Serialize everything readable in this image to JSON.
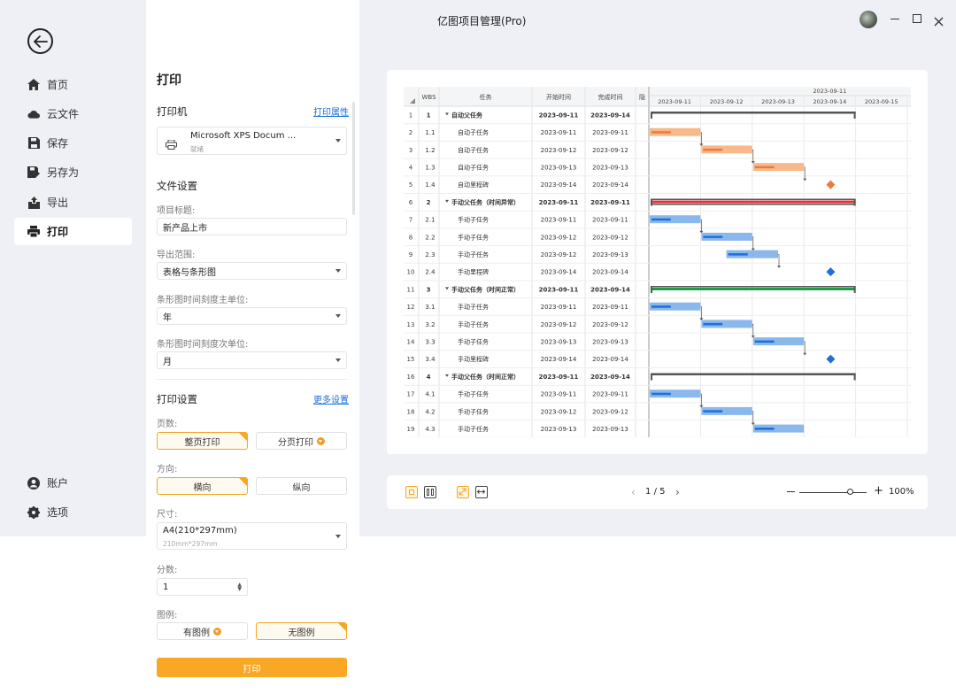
{
  "app": {
    "title": "亿图项目管理(Pro)"
  },
  "nav": {
    "items": [
      {
        "label": "首页",
        "icon": "home-icon"
      },
      {
        "label": "云文件",
        "icon": "cloud-icon"
      },
      {
        "label": "保存",
        "icon": "save-icon"
      },
      {
        "label": "另存为",
        "icon": "save-as-icon"
      },
      {
        "label": "导出",
        "icon": "export-icon"
      },
      {
        "label": "打印",
        "icon": "printer-icon",
        "active": true
      }
    ],
    "bottom": [
      {
        "label": "账户",
        "icon": "account-icon"
      },
      {
        "label": "选项",
        "icon": "gear-icon"
      }
    ]
  },
  "panel": {
    "title": "打印",
    "printer_section": "打印机",
    "printer_props_link": "打印属性",
    "printer_name": "Microsoft XPS Docum ...",
    "printer_status": "就绪",
    "file_settings": "文件设置",
    "project_title_label": "项目标题:",
    "project_title_value": "新产品上市",
    "export_range_label": "导出范围:",
    "export_range_value": "表格与条形图",
    "major_unit_label": "条形图时间刻度主单位:",
    "major_unit_value": "年",
    "minor_unit_label": "条形图时间刻度次单位:",
    "minor_unit_value": "月",
    "print_settings": "打印设置",
    "more_settings_link": "更多设置",
    "pages_label": "页数:",
    "pages_options": [
      "整页打印",
      "分页打印"
    ],
    "orientation_label": "方向:",
    "orientation_options": [
      "横向",
      "纵向"
    ],
    "size_label": "尺寸:",
    "size_value": "A4(210*297mm)",
    "size_sub": "210mm*297mm",
    "copies_label": "分数:",
    "copies_value": "1",
    "legend_label": "图例:",
    "legend_options": [
      "有图例",
      "无图例"
    ],
    "print_button": "打印"
  },
  "gantt": {
    "headers": {
      "wbs": "WBS",
      "task": "任务",
      "start": "开始时间",
      "finish": "完成时间",
      "extra": "隐"
    },
    "timeline_top": "2023-09-11",
    "dates": [
      "2023-09-11",
      "2023-09-12",
      "2023-09-13",
      "2023-09-14",
      "2023-09-15"
    ],
    "rows": [
      {
        "n": "1",
        "wbs": "1",
        "task": "自动父任务",
        "start": "2023-09-11",
        "end": "2023-09-14",
        "summary": true
      },
      {
        "n": "2",
        "wbs": "1.1",
        "task": "自动子任务",
        "start": "2023-09-11",
        "end": "2023-09-11"
      },
      {
        "n": "3",
        "wbs": "1.2",
        "task": "自动子任务",
        "start": "2023-09-12",
        "end": "2023-09-12"
      },
      {
        "n": "4",
        "wbs": "1.3",
        "task": "自动子任务",
        "start": "2023-09-13",
        "end": "2023-09-13"
      },
      {
        "n": "5",
        "wbs": "1.4",
        "task": "自动里程碑",
        "start": "2023-09-14",
        "end": "2023-09-14"
      },
      {
        "n": "6",
        "wbs": "2",
        "task": "手动父任务（时间异常）",
        "start": "2023-09-11",
        "end": "2023-09-11",
        "summary": true
      },
      {
        "n": "7",
        "wbs": "2.1",
        "task": "手动子任务",
        "start": "2023-09-11",
        "end": "2023-09-11"
      },
      {
        "n": "8",
        "wbs": "2.2",
        "task": "手动子任务",
        "start": "2023-09-12",
        "end": "2023-09-12"
      },
      {
        "n": "9",
        "wbs": "2.3",
        "task": "手动子任务",
        "start": "2023-09-12",
        "end": "2023-09-13"
      },
      {
        "n": "10",
        "wbs": "2.4",
        "task": "手动里程碑",
        "start": "2023-09-14",
        "end": "2023-09-14"
      },
      {
        "n": "11",
        "wbs": "3",
        "task": "手动父任务（时间正常）",
        "start": "2023-09-11",
        "end": "2023-09-14",
        "summary": true
      },
      {
        "n": "12",
        "wbs": "3.1",
        "task": "手动子任务",
        "start": "2023-09-11",
        "end": "2023-09-11"
      },
      {
        "n": "13",
        "wbs": "3.2",
        "task": "手动子任务",
        "start": "2023-09-12",
        "end": "2023-09-12"
      },
      {
        "n": "14",
        "wbs": "3.3",
        "task": "手动子任务",
        "start": "2023-09-13",
        "end": "2023-09-13"
      },
      {
        "n": "15",
        "wbs": "3.4",
        "task": "手动里程碑",
        "start": "2023-09-14",
        "end": "2023-09-14"
      },
      {
        "n": "16",
        "wbs": "4",
        "task": "手动父任务（时间正常）",
        "start": "2023-09-11",
        "end": "2023-09-14",
        "summary": true
      },
      {
        "n": "17",
        "wbs": "4.1",
        "task": "手动子任务",
        "start": "2023-09-11",
        "end": "2023-09-11"
      },
      {
        "n": "18",
        "wbs": "4.2",
        "task": "手动子任务",
        "start": "2023-09-12",
        "end": "2023-09-12"
      },
      {
        "n": "19",
        "wbs": "4.3",
        "task": "手动子任务",
        "start": "2023-09-13",
        "end": "2023-09-13"
      }
    ],
    "colors": {
      "orange": "#f7b98a",
      "orange_dark": "#ee7a3a",
      "blue": "#8ab8ec",
      "blue_dark": "#1e6fd9",
      "red": "#e0323a",
      "green": "#1f9e4a",
      "summary": "#555555"
    }
  },
  "toolbar": {
    "page_current": "1",
    "page_sep": "/",
    "page_total": "5",
    "zoom": "100%",
    "zoom_level": 1.0
  },
  "colors": {
    "accent": "#f5a623",
    "link": "#1e6fd9",
    "bg": "#eef0f6"
  }
}
